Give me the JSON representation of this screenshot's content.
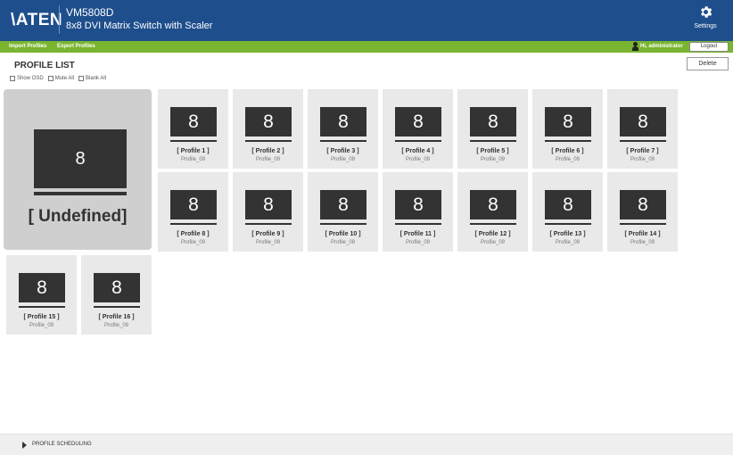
{
  "header": {
    "logo": "\\ATEN",
    "model": "VM5808D",
    "subtitle": "8x8 DVI Matrix Switch with Scaler",
    "settings_label": "Settings"
  },
  "toolbar": {
    "import_label": "Import Profiles",
    "export_label": "Export Profiles",
    "user_greeting": "Hi, administrator",
    "logout_label": "Logout"
  },
  "profile_list": {
    "title": "PROFILE LIST",
    "delete_label": "Delete",
    "options": [
      "Show OSD",
      "Mute All",
      "Blank All"
    ]
  },
  "large_card": {
    "number": "8",
    "name": "[ Undefined]"
  },
  "profiles": [
    {
      "number": "8",
      "name": "[ Profile 1 ]",
      "sub": "Profile_09"
    },
    {
      "number": "8",
      "name": "[ Profile 2 ]",
      "sub": "Profile_09"
    },
    {
      "number": "8",
      "name": "[ Profile 3 ]",
      "sub": "Profile_09"
    },
    {
      "number": "8",
      "name": "[ Profile 4 ]",
      "sub": "Profile_09"
    },
    {
      "number": "8",
      "name": "[ Profile 5 ]",
      "sub": "Profile_09"
    },
    {
      "number": "8",
      "name": "[ Profile 6 ]",
      "sub": "Profile_09"
    },
    {
      "number": "8",
      "name": "[ Profile 7 ]",
      "sub": "Profile_09"
    },
    {
      "number": "8",
      "name": "[ Profile 8 ]",
      "sub": "Profile_09"
    },
    {
      "number": "8",
      "name": "[ Profile 9 ]",
      "sub": "Profile_09"
    },
    {
      "number": "8",
      "name": "[ Profile 10 ]",
      "sub": "Profile_09"
    },
    {
      "number": "8",
      "name": "[ Profile 11 ]",
      "sub": "Profile_09"
    },
    {
      "number": "8",
      "name": "[ Profile 12 ]",
      "sub": "Profile_09"
    },
    {
      "number": "8",
      "name": "[ Profile 13 ]",
      "sub": "Profile_09"
    },
    {
      "number": "8",
      "name": "[ Profile 14 ]",
      "sub": "Profile_09"
    },
    {
      "number": "8",
      "name": "[ Profile 15 ]",
      "sub": "Profile_09"
    },
    {
      "number": "8",
      "name": "[ Profile 16 ]",
      "sub": "Profile_09"
    }
  ],
  "scheduling": {
    "label": "PROFILE SCHEDULING"
  },
  "colors": {
    "header_bg": "#1e4e8c",
    "toolbar_bg": "#79b52f",
    "monitor": "#333333"
  }
}
